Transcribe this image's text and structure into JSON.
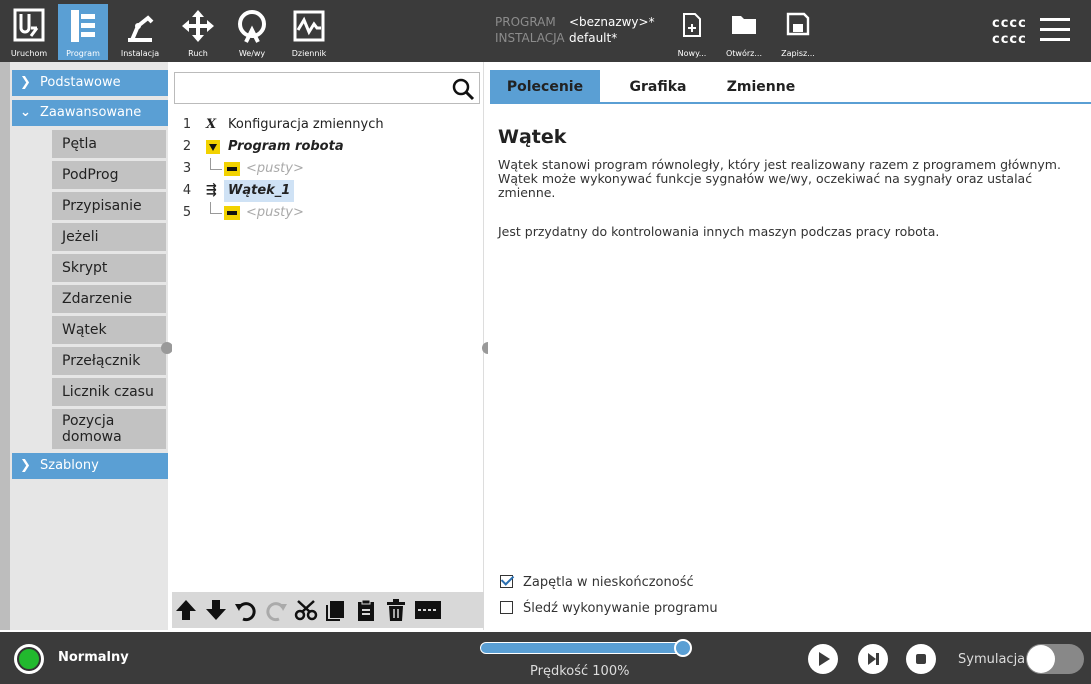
{
  "header": {
    "nav": [
      {
        "label": "Uruchom",
        "icon": "ur-logo-icon"
      },
      {
        "label": "Program",
        "icon": "program-icon",
        "active": true
      },
      {
        "label": "Instalacja",
        "icon": "installation-icon"
      },
      {
        "label": "Ruch",
        "icon": "move-icon"
      },
      {
        "label": "We/wy",
        "icon": "io-icon"
      },
      {
        "label": "Dziennik",
        "icon": "log-icon"
      }
    ],
    "program_key": "PROGRAM",
    "program_value": "<beznazwy>*",
    "installation_key": "INSTALACJA",
    "installation_value": "default*",
    "new_label": "Nowy...",
    "open_label": "Otwórz...",
    "save_label": "Zapisz...",
    "user_line1": "cccc",
    "user_line2": "cccc"
  },
  "sidebar": {
    "cat_basic": "Podstawowe",
    "cat_advanced": "Zaawansowane",
    "cat_templates": "Szablony",
    "items": [
      "Pętla",
      "PodProg",
      "Przypisanie",
      "Jeżeli",
      "Skrypt",
      "Zdarzenie",
      "Wątek",
      "Przełącznik",
      "Licznik czasu",
      "Pozycja domowa"
    ]
  },
  "search": {
    "placeholder": ""
  },
  "tree": {
    "rows": [
      {
        "num": "1",
        "text": "Konfiguracja zmiennych"
      },
      {
        "num": "2",
        "text": "Program robota"
      },
      {
        "num": "3",
        "text": "<pusty>"
      },
      {
        "num": "4",
        "text": "Wątek_1"
      },
      {
        "num": "5",
        "text": "<pusty>"
      }
    ]
  },
  "right": {
    "tabs": [
      "Polecenie",
      "Grafika",
      "Zmienne"
    ],
    "title": "Wątek",
    "desc1": "Wątek stanowi program równoległy, który jest realizowany razem z programem głównym. Wątek może wykonywać funkcje sygnałów we/wy, oczekiwać na sygnały oraz ustalać zmienne.",
    "desc2": "Jest przydatny do kontrolowania innych maszyn podczas pracy robota.",
    "opt_loop": "Zapętla w nieskończoność",
    "opt_loop_checked": true,
    "opt_trace": "Śledź wykonywanie programu",
    "opt_trace_checked": false
  },
  "footer": {
    "status": "Normalny",
    "speed": "Prędkość 100%",
    "speed_value": 100,
    "simulation": "Symulacja"
  },
  "colors": {
    "accent": "#5a9fd4",
    "header": "#3b3b3b",
    "status_ok": "#22b92e",
    "node_yellow": "#f2d200"
  }
}
